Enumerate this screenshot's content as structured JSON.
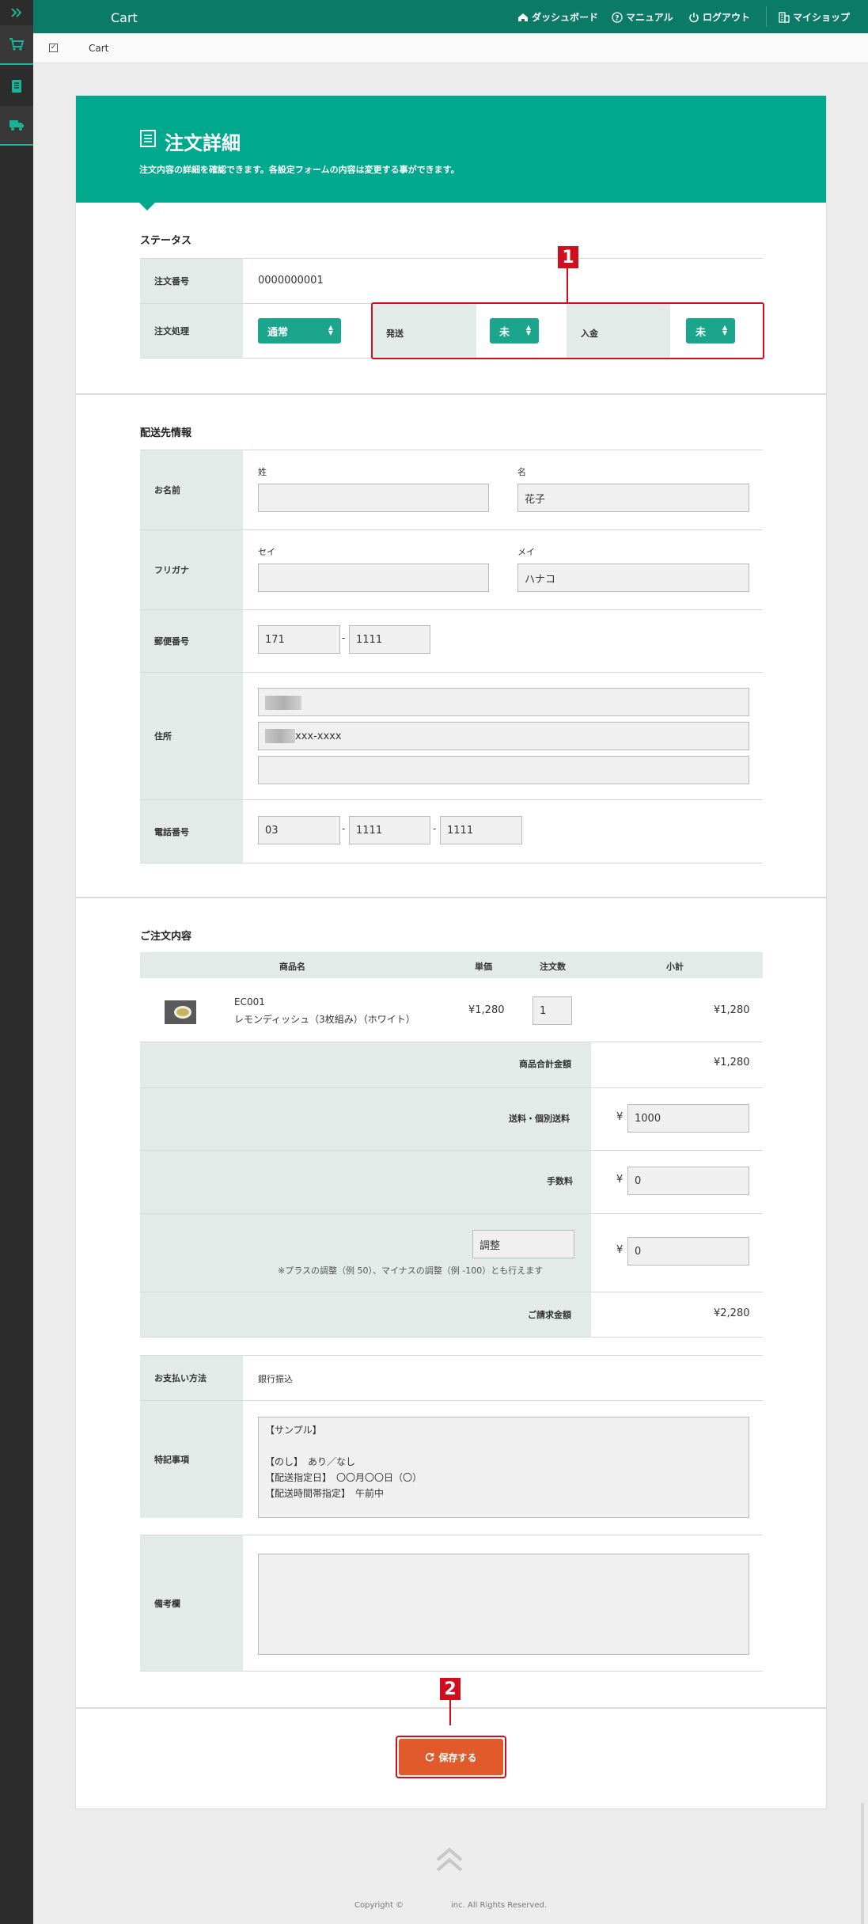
{
  "app": {
    "title": "Cart",
    "breadcrumb": "Cart"
  },
  "topnav": {
    "dashboard": "ダッシュボード",
    "manual": "マニュアル",
    "logout": "ログアウト",
    "myshop": "マイショップ"
  },
  "page": {
    "title": "注文詳細",
    "description": "注文内容の詳細を確認できます。各設定フォームの内容は変更する事ができます。"
  },
  "status": {
    "heading": "ステータス",
    "order_number_label": "注文番号",
    "order_number": "0000000001",
    "processing_label": "注文処理",
    "processing_value": "通常",
    "shipping_label": "発送",
    "shipping_value": "未",
    "payment_label": "入金",
    "payment_value": "未"
  },
  "delivery": {
    "heading": "配送先情報",
    "name_label": "お名前",
    "last_label": "姓",
    "last_value": "",
    "first_label": "名",
    "first_value": "花子",
    "kana_label": "フリガナ",
    "sei_label": "セイ",
    "sei_value": "",
    "mei_label": "メイ",
    "mei_value": "ハナコ",
    "zip_label": "郵便番号",
    "zip1": "171",
    "zip2": "1111",
    "dash": "-",
    "address_label": "住所",
    "address2": "xxx-xxxx",
    "phone_label": "電話番号",
    "tel1": "03",
    "tel2": "1111",
    "tel3": "1111"
  },
  "order": {
    "heading": "ご注文内容",
    "headers": {
      "name": "商品名",
      "price": "単価",
      "qty": "注文数",
      "subtotal": "小計"
    },
    "item": {
      "code": "EC001",
      "name": "レモンディッシュ（3枚組み）（ホワイト）",
      "price": "¥1,280",
      "qty": "1",
      "subtotal": "¥1,280"
    },
    "total_label": "商品合計金額",
    "total_value": "¥1,280",
    "shipping_label": "送料・個別送料",
    "shipping_value": "1000",
    "fee_label": "手数料",
    "fee_value": "0",
    "adjust_label": "調整",
    "adjust_value": "0",
    "adjust_note": "※プラスの調整（例 50）、マイナスの調整（例 -100）とも行えます",
    "yen": "¥",
    "grand_label": "ご請求金額",
    "grand_value": "¥2,280"
  },
  "payment": {
    "method_label": "お支払い方法",
    "method_value": "銀行振込",
    "notes_label": "特記事項",
    "notes_line1": "【サンプル】",
    "notes_line2": "【のし】　あり／なし",
    "notes_line3": "【配送指定日】　〇〇月〇〇日（〇）",
    "notes_line4": "【配送時間帯指定】　午前中",
    "remarks_label": "備考欄",
    "remarks_value": ""
  },
  "save_button": "保存する",
  "callouts": {
    "one": "1",
    "two": "2"
  },
  "footer": {
    "copyright": "Copyright ©",
    "rights": "inc. All Rights Reserved."
  },
  "colors": {
    "primary": "#00a88e",
    "dark": "#0b7b67",
    "save": "#e05a2b",
    "callout": "#d10e1d"
  }
}
